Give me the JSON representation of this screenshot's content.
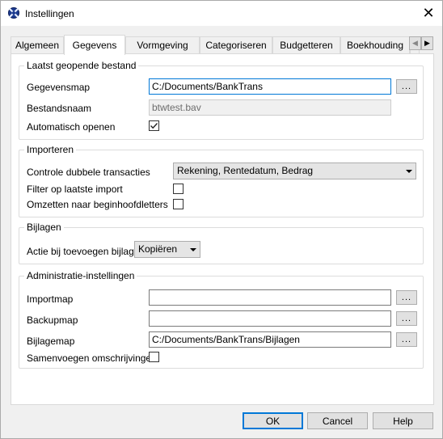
{
  "window": {
    "title": "Instellingen",
    "close_symbol": "✕",
    "app_icon": "settings-app-icon"
  },
  "tabs": [
    {
      "label": "Algemeen",
      "active": false
    },
    {
      "label": "Gegevens",
      "active": true
    },
    {
      "label": "Vormgeving",
      "active": false
    },
    {
      "label": "Categoriseren",
      "active": false
    },
    {
      "label": "Budgetteren",
      "active": false
    },
    {
      "label": "Boekhouding",
      "active": false
    }
  ],
  "tab_scroll": {
    "left": "◀",
    "right": "▶"
  },
  "last_file": {
    "title": "Laatst geopende bestand",
    "data_folder_label": "Gegevensmap",
    "data_folder_value": "C:/Documents/BankTrans",
    "filename_label": "Bestandsnaam",
    "filename_value": "btwtest.bav",
    "auto_open_label": "Automatisch openen",
    "auto_open_checked": true
  },
  "import": {
    "title": "Importeren",
    "duplicate_check_label": "Controle dubbele transacties",
    "duplicate_check_value": "Rekening, Rentedatum, Bedrag",
    "filter_label": "Filter op laatste import",
    "filter_checked": false,
    "capitalize_label": "Omzetten naar beginhoofdletters",
    "capitalize_checked": false
  },
  "attachments": {
    "title": "Bijlagen",
    "action_label": "Actie bij toevoegen bijlage",
    "action_value": "Kopiëren"
  },
  "admin": {
    "title": "Administratie-instellingen",
    "import_folder_label": "Importmap",
    "import_folder_value": "",
    "backup_folder_label": "Backupmap",
    "backup_folder_value": "",
    "attachment_folder_label": "Bijlagemap",
    "attachment_folder_value": "C:/Documents/BankTrans/Bijlagen",
    "merge_descriptions_label": "Samenvoegen omschrijvingen",
    "merge_descriptions_checked": false
  },
  "browse_label": "...",
  "buttons": {
    "ok": "OK",
    "cancel": "Cancel",
    "help": "Help"
  },
  "colors": {
    "accent": "#0078d7"
  }
}
